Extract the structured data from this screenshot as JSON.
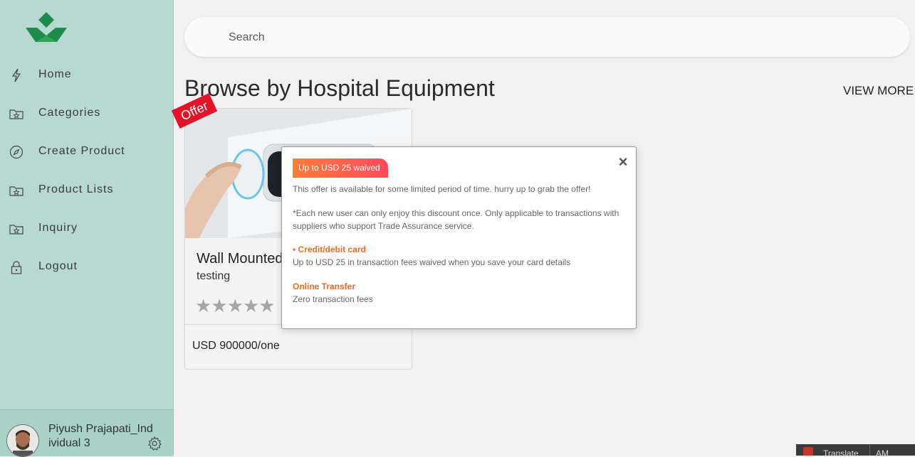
{
  "sidebar": {
    "items": [
      {
        "label": "Home",
        "icon": "bolt-icon"
      },
      {
        "label": "Categories",
        "icon": "folder-star-icon"
      },
      {
        "label": "Create Product",
        "icon": "compass-icon"
      },
      {
        "label": "Product Lists",
        "icon": "folder-star-icon"
      },
      {
        "label": "Inquiry",
        "icon": "folder-star-icon"
      },
      {
        "label": "Logout",
        "icon": "lock-icon"
      }
    ],
    "user": {
      "name": "Piyush Prajapati_Individual 3"
    }
  },
  "search": {
    "placeholder": "Search"
  },
  "section": {
    "title": "Browse by Hospital Equipment",
    "view_more": "VIEW MORE"
  },
  "card": {
    "ribbon": "Offer",
    "title": "Wall Mounted",
    "subtitle": "testing",
    "stars": "★★★★★",
    "rating": 0,
    "price": "USD 900000/one"
  },
  "modal": {
    "close": "×",
    "badge": "Up to USD 25 waived",
    "intro": "This offer is available for some limited period of time. hurry up to grab the offer!",
    "note": "*Each new user can only enjoy this discount once. Only applicable to transactions with suppliers who support Trade Assurance service.",
    "card_head": "• Credit/debit card",
    "card_text": "Up to USD 25 in transaction fees waived when you save your card details",
    "transfer_head": "Online Transfer",
    "transfer_text": "Zero transaction fees"
  },
  "translate": {
    "label": "Translate",
    "suffix": "AM"
  },
  "colors": {
    "sidebar": "#b7d9d2",
    "accent": "#f26a22",
    "ribbon": "#e3142a",
    "logo": "#1e8a4c"
  }
}
